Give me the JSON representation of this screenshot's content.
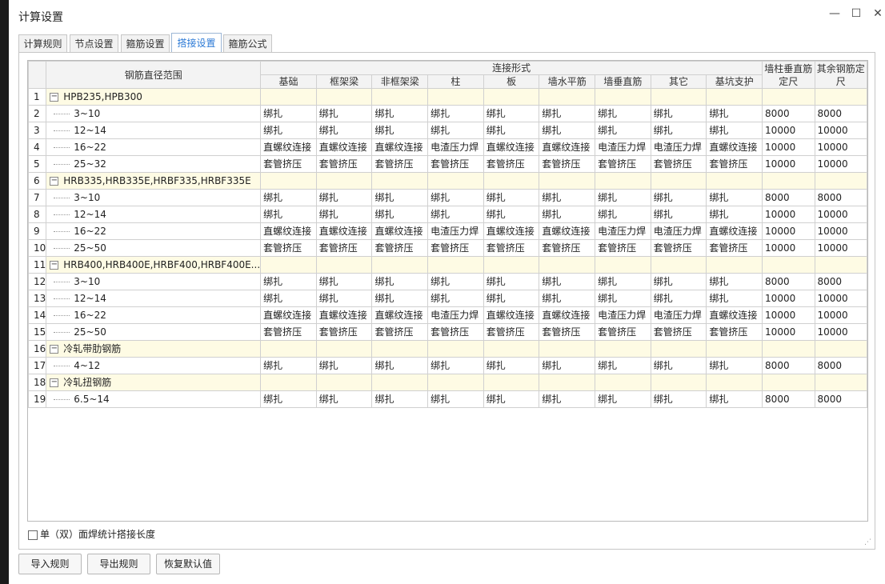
{
  "window": {
    "title": "计算设置",
    "minimize_glyph": "—",
    "maximize_glyph": "☐",
    "close_glyph": "✕"
  },
  "tabs": [
    {
      "label": "计算规则",
      "active": false
    },
    {
      "label": "节点设置",
      "active": false
    },
    {
      "label": "箍筋设置",
      "active": false
    },
    {
      "label": "搭接设置",
      "active": true
    },
    {
      "label": "箍筋公式",
      "active": false
    }
  ],
  "grid": {
    "header": {
      "range": "钢筋直径范围",
      "connection_group": "连接形式",
      "connection_cols": [
        "基础",
        "框架梁",
        "非框架梁",
        "柱",
        "板",
        "墙水平筋",
        "墙垂直筋",
        "其它",
        "基坑支护"
      ],
      "wall_vertical_length": "墙柱垂直筋定尺",
      "other_length": "其余钢筋定尺"
    },
    "rows": [
      {
        "n": "1",
        "group": true,
        "label": "HPB235,HPB300"
      },
      {
        "n": "2",
        "label": "3~10",
        "cells": [
          "绑扎",
          "绑扎",
          "绑扎",
          "绑扎",
          "绑扎",
          "绑扎",
          "绑扎",
          "绑扎",
          "绑扎",
          "8000",
          "8000"
        ]
      },
      {
        "n": "3",
        "label": "12~14",
        "cells": [
          "绑扎",
          "绑扎",
          "绑扎",
          "绑扎",
          "绑扎",
          "绑扎",
          "绑扎",
          "绑扎",
          "绑扎",
          "10000",
          "10000"
        ]
      },
      {
        "n": "4",
        "label": "16~22",
        "cells": [
          "直螺纹连接",
          "直螺纹连接",
          "直螺纹连接",
          "电渣压力焊",
          "直螺纹连接",
          "直螺纹连接",
          "电渣压力焊",
          "电渣压力焊",
          "直螺纹连接",
          "10000",
          "10000"
        ]
      },
      {
        "n": "5",
        "label": "25~32",
        "cells": [
          "套管挤压",
          "套管挤压",
          "套管挤压",
          "套管挤压",
          "套管挤压",
          "套管挤压",
          "套管挤压",
          "套管挤压",
          "套管挤压",
          "10000",
          "10000"
        ]
      },
      {
        "n": "6",
        "group": true,
        "label": "HRB335,HRB335E,HRBF335,HRBF335E"
      },
      {
        "n": "7",
        "label": "3~10",
        "cells": [
          "绑扎",
          "绑扎",
          "绑扎",
          "绑扎",
          "绑扎",
          "绑扎",
          "绑扎",
          "绑扎",
          "绑扎",
          "8000",
          "8000"
        ]
      },
      {
        "n": "8",
        "label": "12~14",
        "cells": [
          "绑扎",
          "绑扎",
          "绑扎",
          "绑扎",
          "绑扎",
          "绑扎",
          "绑扎",
          "绑扎",
          "绑扎",
          "10000",
          "10000"
        ]
      },
      {
        "n": "9",
        "label": "16~22",
        "cells": [
          "直螺纹连接",
          "直螺纹连接",
          "直螺纹连接",
          "电渣压力焊",
          "直螺纹连接",
          "直螺纹连接",
          "电渣压力焊",
          "电渣压力焊",
          "直螺纹连接",
          "10000",
          "10000"
        ]
      },
      {
        "n": "10",
        "label": "25~50",
        "cells": [
          "套管挤压",
          "套管挤压",
          "套管挤压",
          "套管挤压",
          "套管挤压",
          "套管挤压",
          "套管挤压",
          "套管挤压",
          "套管挤压",
          "10000",
          "10000"
        ]
      },
      {
        "n": "11",
        "group": true,
        "label": "HRB400,HRB400E,HRBF400,HRBF400E..."
      },
      {
        "n": "12",
        "label": "3~10",
        "cells": [
          "绑扎",
          "绑扎",
          "绑扎",
          "绑扎",
          "绑扎",
          "绑扎",
          "绑扎",
          "绑扎",
          "绑扎",
          "8000",
          "8000"
        ]
      },
      {
        "n": "13",
        "label": "12~14",
        "cells": [
          "绑扎",
          "绑扎",
          "绑扎",
          "绑扎",
          "绑扎",
          "绑扎",
          "绑扎",
          "绑扎",
          "绑扎",
          "10000",
          "10000"
        ]
      },
      {
        "n": "14",
        "label": "16~22",
        "cells": [
          "直螺纹连接",
          "直螺纹连接",
          "直螺纹连接",
          "电渣压力焊",
          "直螺纹连接",
          "直螺纹连接",
          "电渣压力焊",
          "电渣压力焊",
          "直螺纹连接",
          "10000",
          "10000"
        ]
      },
      {
        "n": "15",
        "label": "25~50",
        "cells": [
          "套管挤压",
          "套管挤压",
          "套管挤压",
          "套管挤压",
          "套管挤压",
          "套管挤压",
          "套管挤压",
          "套管挤压",
          "套管挤压",
          "10000",
          "10000"
        ]
      },
      {
        "n": "16",
        "group": true,
        "label": "冷轧带肋钢筋"
      },
      {
        "n": "17",
        "label": "4~12",
        "cells": [
          "绑扎",
          "绑扎",
          "绑扎",
          "绑扎",
          "绑扎",
          "绑扎",
          "绑扎",
          "绑扎",
          "绑扎",
          "8000",
          "8000"
        ]
      },
      {
        "n": "18",
        "group": true,
        "label": "冷轧扭钢筋"
      },
      {
        "n": "19",
        "label": "6.5~14",
        "cells": [
          "绑扎",
          "绑扎",
          "绑扎",
          "绑扎",
          "绑扎",
          "绑扎",
          "绑扎",
          "绑扎",
          "绑扎",
          "8000",
          "8000"
        ]
      }
    ]
  },
  "options": {
    "weld_checkbox_label": "单（双）面焊统计搭接长度",
    "weld_checked": false
  },
  "buttons": {
    "import": "导入规则",
    "export": "导出规则",
    "restore": "恢复默认值"
  }
}
